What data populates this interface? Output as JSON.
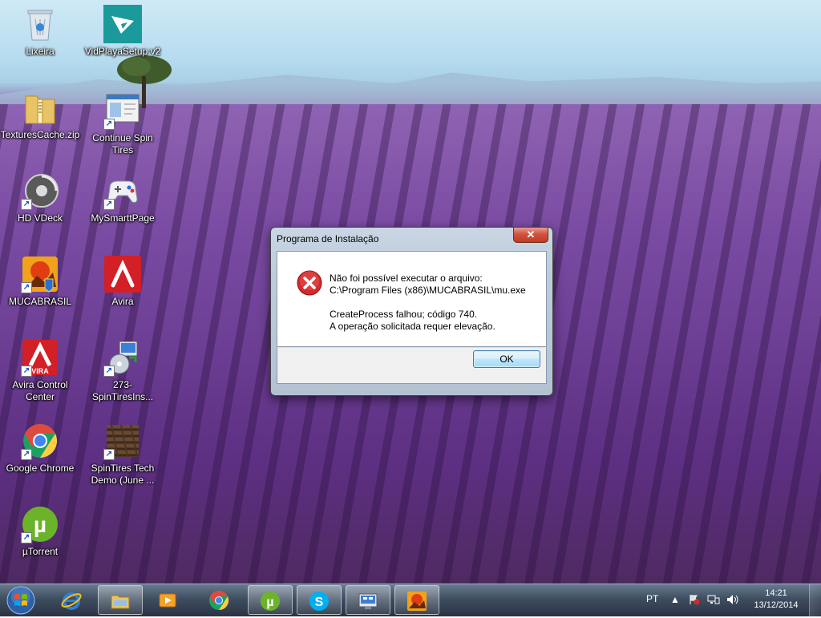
{
  "desktop": {
    "icons": [
      {
        "label": "Lixeira"
      },
      {
        "label": "VidPlayaSetup v2"
      },
      {
        "label": "TexturesCache.zip"
      },
      {
        "label": "Continue Spin Tires"
      },
      {
        "label": "HD VDeck"
      },
      {
        "label": "MySmarttPage"
      },
      {
        "label": "MUCABRASIL"
      },
      {
        "label": "Avira"
      },
      {
        "label": "Avira Control Center"
      },
      {
        "label": "273-SpinTiresIns..."
      },
      {
        "label": "Google Chrome"
      },
      {
        "label": "SpinTires Tech Demo (June ..."
      },
      {
        "label": "µTorrent"
      }
    ]
  },
  "dialog": {
    "title": "Programa de Instalação",
    "close_label": "✕",
    "line1": "Não foi possível executar o arquivo:",
    "line2": "C:\\Program Files (x86)\\MUCABRASIL\\mu.exe",
    "line3": "CreateProcess falhou; código 740.",
    "line4": "A operação solicitada requer elevação.",
    "ok_label": "OK"
  },
  "taskbar": {
    "items": [
      {
        "icon": "internet-explorer-icon"
      },
      {
        "icon": "windows-explorer-icon"
      },
      {
        "icon": "media-player-icon"
      },
      {
        "icon": "google-chrome-icon"
      },
      {
        "icon": "utorrent-icon"
      },
      {
        "icon": "skype-icon"
      },
      {
        "icon": "control-panel-icon"
      },
      {
        "icon": "mucabrasil-icon"
      }
    ],
    "language": "PT",
    "time": "14:21",
    "date": "13/12/2014"
  },
  "colors": {
    "error_red": "#d42a2a",
    "avira_red": "#d31f26",
    "chrome_green": "#1aa260",
    "utorrent_green": "#6bb42a",
    "skype_blue": "#00aff0"
  }
}
